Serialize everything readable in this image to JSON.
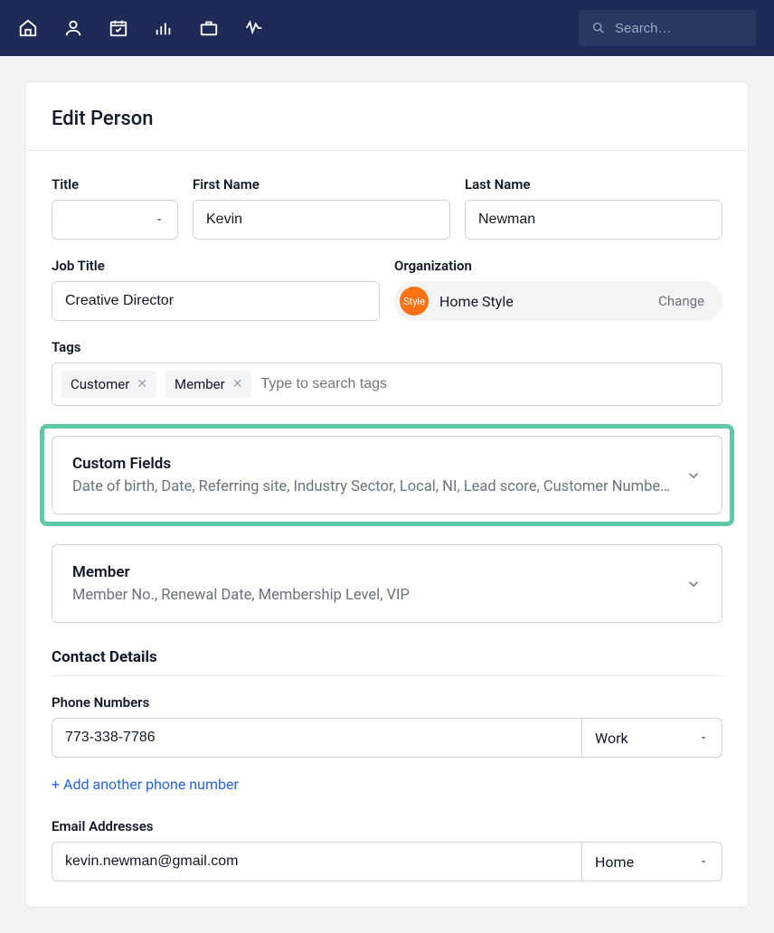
{
  "topbar": {
    "search_placeholder": "Search…"
  },
  "page": {
    "title": "Edit Person"
  },
  "fields": {
    "title_label": "Title",
    "title_value": "",
    "first_name_label": "First Name",
    "first_name_value": "Kevin",
    "last_name_label": "Last Name",
    "last_name_value": "Newman",
    "job_title_label": "Job Title",
    "job_title_value": "Creative Director",
    "organization_label": "Organization",
    "organization_value": "Home Style",
    "organization_change": "Change",
    "org_avatar_text": "Style",
    "tags_label": "Tags",
    "tags": [
      "Customer",
      "Member"
    ],
    "tags_placeholder": "Type to search tags"
  },
  "custom_fields": {
    "title": "Custom Fields",
    "subtitle": "Date of birth, Date, Referring site, Industry Sector, Local, NI, Lead score, Customer Number, C…"
  },
  "member": {
    "title": "Member",
    "subtitle": "Member No., Renewal Date, Membership Level, VIP"
  },
  "contact": {
    "section_title": "Contact Details",
    "phone_label": "Phone Numbers",
    "phone_value": "773-338-7786",
    "phone_type": "Work",
    "add_phone": "+ Add another phone number",
    "email_label": "Email Addresses",
    "email_value": "kevin.newman@gmail.com",
    "email_type": "Home"
  }
}
